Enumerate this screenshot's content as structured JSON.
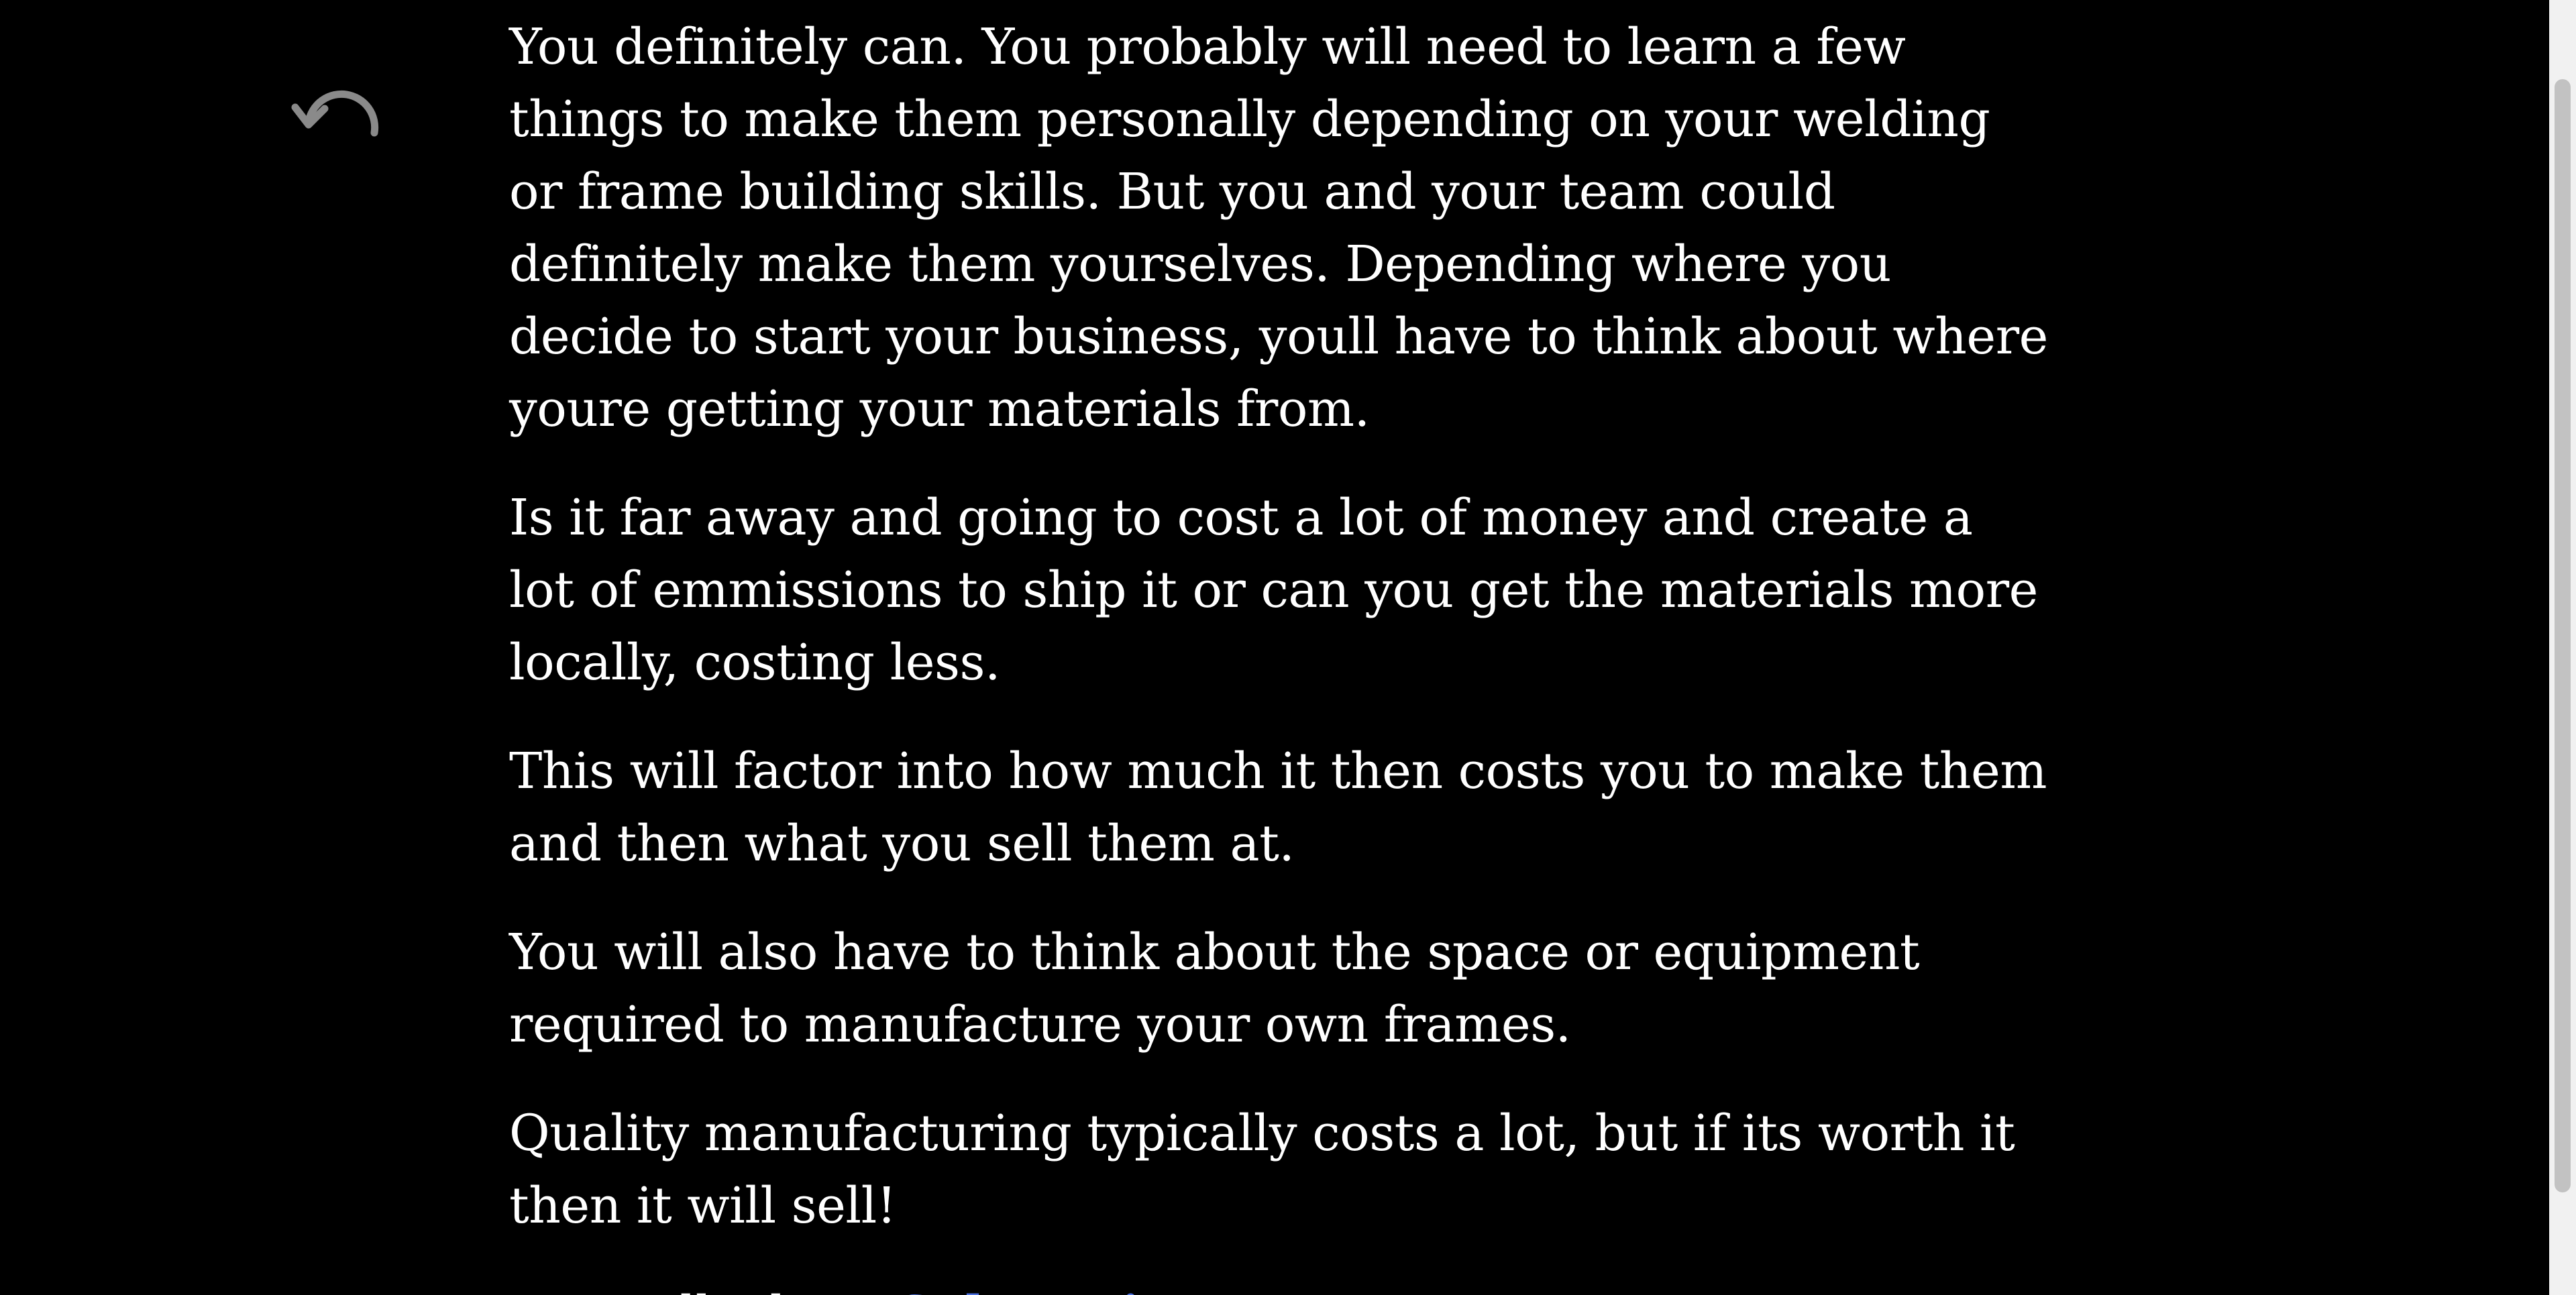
{
  "icons": {
    "undo": "undo-arrow-icon"
  },
  "colors": {
    "background": "#000000",
    "text": "#ffffff",
    "link": "#4a6fe0",
    "undo_icon": "#8a8a8a"
  },
  "content": {
    "paragraphs": [
      "You definitely can. You probably will need to learn a few things to make them personally depending on your welding or frame building skills. But you and your team could definitely make them yourselves. Depending where you decide to start your business, youll have to think about where youre getting your materials from.",
      "Is it far away and going to cost a lot of money and create a lot of emmissions to ship it or can you get the materials more locally, costing less.",
      "This will factor into how much it then costs you to make them and then what you sell them at.",
      "You will also have to think about the space or equipment required to manufacture your own frames.",
      "Quality manufacturing typically costs a lot, but if its worth it then it will sell!"
    ],
    "final_prefix": "Lets talk about ",
    "final_link": "Sale options"
  }
}
